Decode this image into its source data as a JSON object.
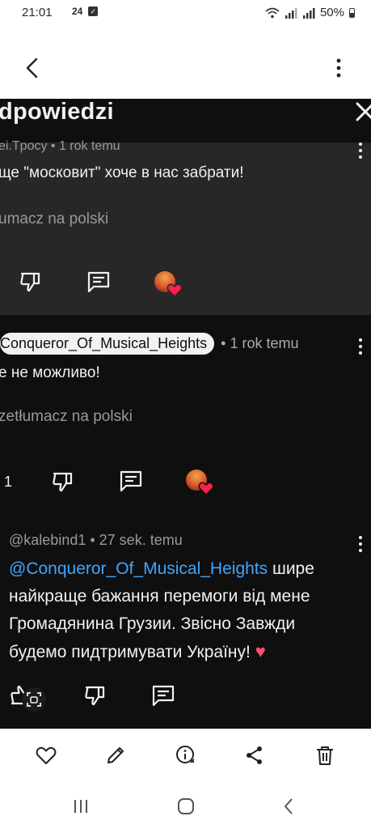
{
  "status_bar": {
    "time": "21:01",
    "left_badge": "24",
    "battery": "50%"
  },
  "panel": {
    "title": "dpowiedzi"
  },
  "comments": [
    {
      "meta": "ei.Tpocy • 1 rok temu",
      "text": "ще \"московит\" хоче в нас забрати!",
      "translate": "umacz na polski"
    },
    {
      "author": "Conqueror_Of_Musical_Heights",
      "time": "• 1 rok temu",
      "text": "е не можливо!",
      "translate": "zetłumacz na polski",
      "like_count": "1"
    },
    {
      "author": "@kalebind1",
      "time": "• 27 sek. temu",
      "mention": "@Conqueror_Of_Musical_Heights",
      "text": " шире найкраще бажання перемоги від мене Громадянина Грузии. Звісно Завжди будемо пидтримувати Україну! ",
      "emoji": "♥"
    }
  ],
  "colors": {
    "background": "#0f0f0f",
    "highlight_background": "#272727",
    "mention": "#3ea6ff",
    "heart": "#ff1f4b"
  }
}
